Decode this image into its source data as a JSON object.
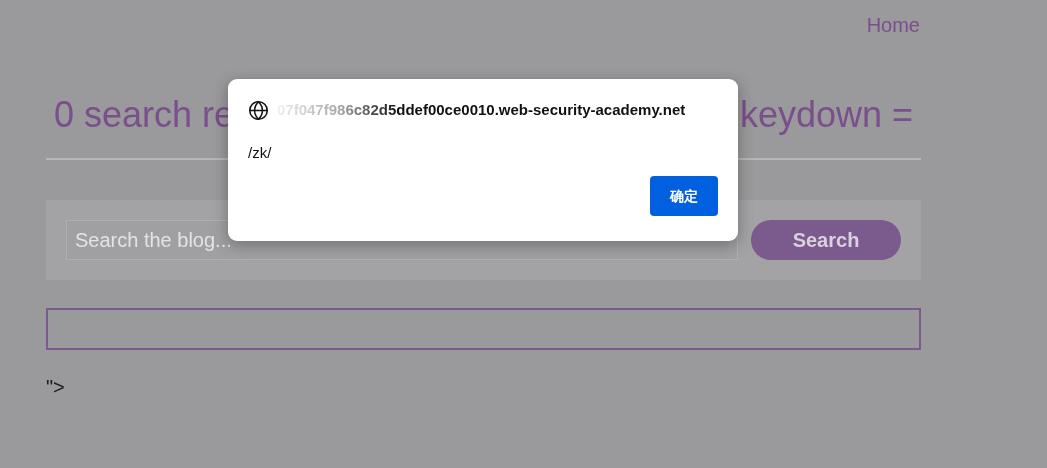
{
  "nav": {
    "home_link": "Home"
  },
  "heading": {
    "visible_start": "0 search re",
    "visible_end": "keydown ="
  },
  "search": {
    "placeholder": "Search the blog...",
    "button": "Search"
  },
  "stray_text": "\">",
  "dialog": {
    "host": "07f047f986c82d5ddef00ce0010.web-security-academy.net",
    "message": "/zk/",
    "ok_button": "确定"
  }
}
